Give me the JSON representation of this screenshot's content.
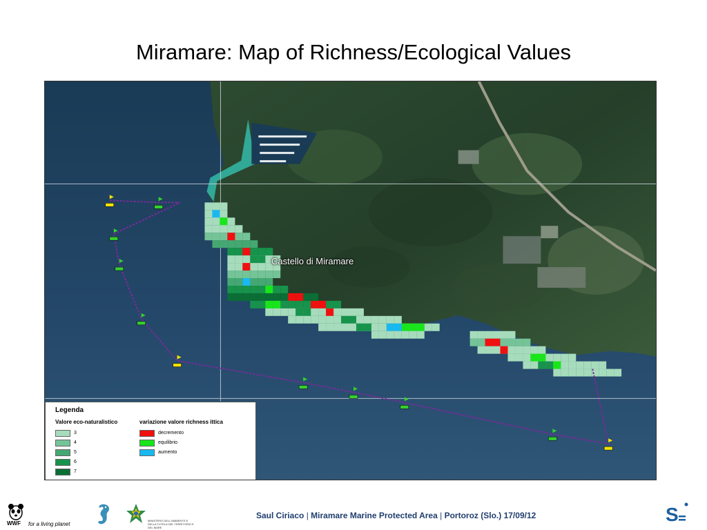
{
  "slide": {
    "title": "Miramare: Map of Richness/Ecological Values",
    "footer": {
      "author": "Saul Ciriaco",
      "area": "Miramare Marine Protected Area",
      "event": "Portoroz (Slo.) 17/09/12"
    }
  },
  "map": {
    "place_label": "Castello di Miramare",
    "colors": {
      "sea": "#1d3a55",
      "land": "#2c4a32",
      "grid_line": "#c9d2d8",
      "boundary_line": "#7a2a9a",
      "buoy": "#f2e200",
      "marker": "#35d02f"
    },
    "legend": {
      "title": "Legenda",
      "col1_title": "Valore eco-naturalistico",
      "col2_title": "variazione valore richness ittica",
      "eco_values": [
        {
          "label": "3",
          "color": "#a6dcbc"
        },
        {
          "label": "4",
          "color": "#74c497"
        },
        {
          "label": "5",
          "color": "#45a872"
        },
        {
          "label": "6",
          "color": "#17934c"
        },
        {
          "label": "7",
          "color": "#0a6e35"
        }
      ],
      "richness_changes": [
        {
          "label": "decremento",
          "color": "#f01010"
        },
        {
          "label": "equilibrio",
          "color": "#19e61a"
        },
        {
          "label": "aumento",
          "color": "#1ab8f0"
        }
      ]
    }
  },
  "logos": {
    "wwf_name": "WWF",
    "wwf_tagline": "for a living planet",
    "ministry_text": "MINISTERO DELL'AMBIENTE E DELLA TUTELA DEL TERRITORIO E DEL MARE",
    "right_icon": "s-brand-icon"
  }
}
